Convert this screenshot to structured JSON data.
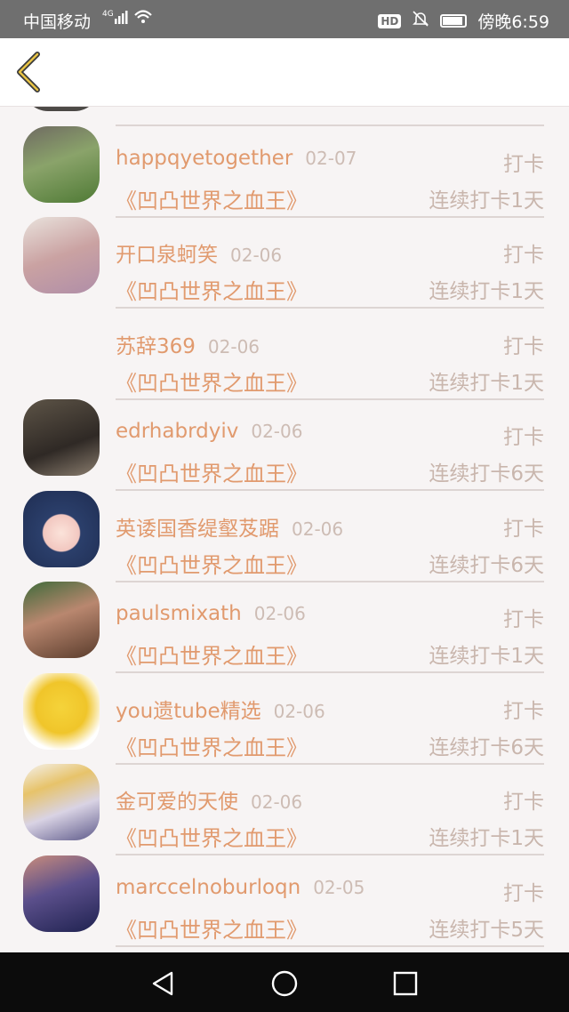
{
  "status_bar": {
    "carrier": "中国移动",
    "network": "4G",
    "hd_label": "HD",
    "time": "傍晚6:59"
  },
  "colors": {
    "name": "#e19a6e",
    "book": "#e19a6e",
    "muted": "#c9b6ad",
    "date": "#cdbcb4",
    "status_bar_bg": "#6f6f6f",
    "nav_bar_bg": "#0c0c0c"
  },
  "header": {
    "back_icon": "chevron-left-icon"
  },
  "rows": [
    {
      "name": "happqyetogether",
      "date": "02-07",
      "action": "打卡",
      "book": "《凹凸世界之血王》",
      "streak": "连续打卡1天"
    },
    {
      "name": "开口泉蚵笑",
      "date": "02-06",
      "action": "打卡",
      "book": "《凹凸世界之血王》",
      "streak": "连续打卡1天"
    },
    {
      "name": "苏辞369",
      "date": "02-06",
      "action": "打卡",
      "book": "《凹凸世界之血王》",
      "streak": "连续打卡1天"
    },
    {
      "name": "edrhabrdyiv",
      "date": "02-06",
      "action": "打卡",
      "book": "《凹凸世界之血王》",
      "streak": "连续打卡6天"
    },
    {
      "name": "英诿国香缇壑芨踞",
      "date": "02-06",
      "action": "打卡",
      "book": "《凹凸世界之血王》",
      "streak": "连续打卡6天"
    },
    {
      "name": "paulsmixath",
      "date": "02-06",
      "action": "打卡",
      "book": "《凹凸世界之血王》",
      "streak": "连续打卡1天"
    },
    {
      "name": "you遗tube精选",
      "date": "02-06",
      "action": "打卡",
      "book": "《凹凸世界之血王》",
      "streak": "连续打卡6天"
    },
    {
      "name": "金可爱的天使",
      "date": "02-06",
      "action": "打卡",
      "book": "《凹凸世界之血王》",
      "streak": "连续打卡1天"
    },
    {
      "name": "marccelnoburloqn",
      "date": "02-05",
      "action": "打卡",
      "book": "《凹凸世界之血王》",
      "streak": "连续打卡5天"
    }
  ],
  "nav_bar": {
    "back": "triangle-back-icon",
    "home": "circle-home-icon",
    "recent": "square-recent-icon"
  }
}
